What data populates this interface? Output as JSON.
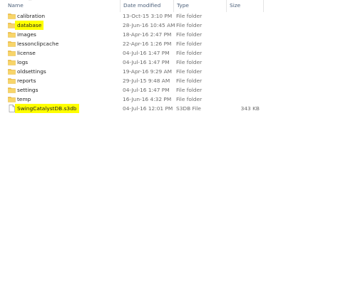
{
  "columns": {
    "name": "Name",
    "date_modified": "Date modified",
    "type": "Type",
    "size": "Size"
  },
  "files": [
    {
      "name": "calibration",
      "date": "13-Oct-15 3:10 PM",
      "type": "File folder",
      "size": "",
      "icon": "folder-icon",
      "highlighted": false
    },
    {
      "name": "database",
      "date": "28-Jun-16 10:45 AM",
      "type": "File folder",
      "size": "",
      "icon": "folder-icon",
      "highlighted": true
    },
    {
      "name": "images",
      "date": "18-Apr-16 2:47 PM",
      "type": "File folder",
      "size": "",
      "icon": "folder-icon",
      "highlighted": false
    },
    {
      "name": "lessonclipcache",
      "date": "22-Apr-16 1:26 PM",
      "type": "File folder",
      "size": "",
      "icon": "folder-icon",
      "highlighted": false
    },
    {
      "name": "license",
      "date": "04-Jul-16 1:47 PM",
      "type": "File folder",
      "size": "",
      "icon": "folder-icon",
      "highlighted": false
    },
    {
      "name": "logs",
      "date": "04-Jul-16 1:47 PM",
      "type": "File folder",
      "size": "",
      "icon": "folder-icon",
      "highlighted": false
    },
    {
      "name": "oldsettings",
      "date": "19-Apr-16 9:29 AM",
      "type": "File folder",
      "size": "",
      "icon": "folder-icon",
      "highlighted": false
    },
    {
      "name": "reports",
      "date": "29-Jul-15 9:48 AM",
      "type": "File folder",
      "size": "",
      "icon": "folder-icon",
      "highlighted": false
    },
    {
      "name": "settings",
      "date": "04-Jul-16 1:47 PM",
      "type": "File folder",
      "size": "",
      "icon": "folder-icon",
      "highlighted": false
    },
    {
      "name": "temp",
      "date": "16-Jun-16 4:32 PM",
      "type": "File folder",
      "size": "",
      "icon": "folder-icon",
      "highlighted": false
    },
    {
      "name": "SwingCatalystDB.s3db",
      "date": "04-Jul-16 12:01 PM",
      "type": "S3DB File",
      "size": "343 KB",
      "icon": "file-icon",
      "highlighted": true
    }
  ],
  "colors": {
    "highlight": "#ffff00",
    "folder": "#f3c244",
    "header_text": "#4c607a"
  }
}
